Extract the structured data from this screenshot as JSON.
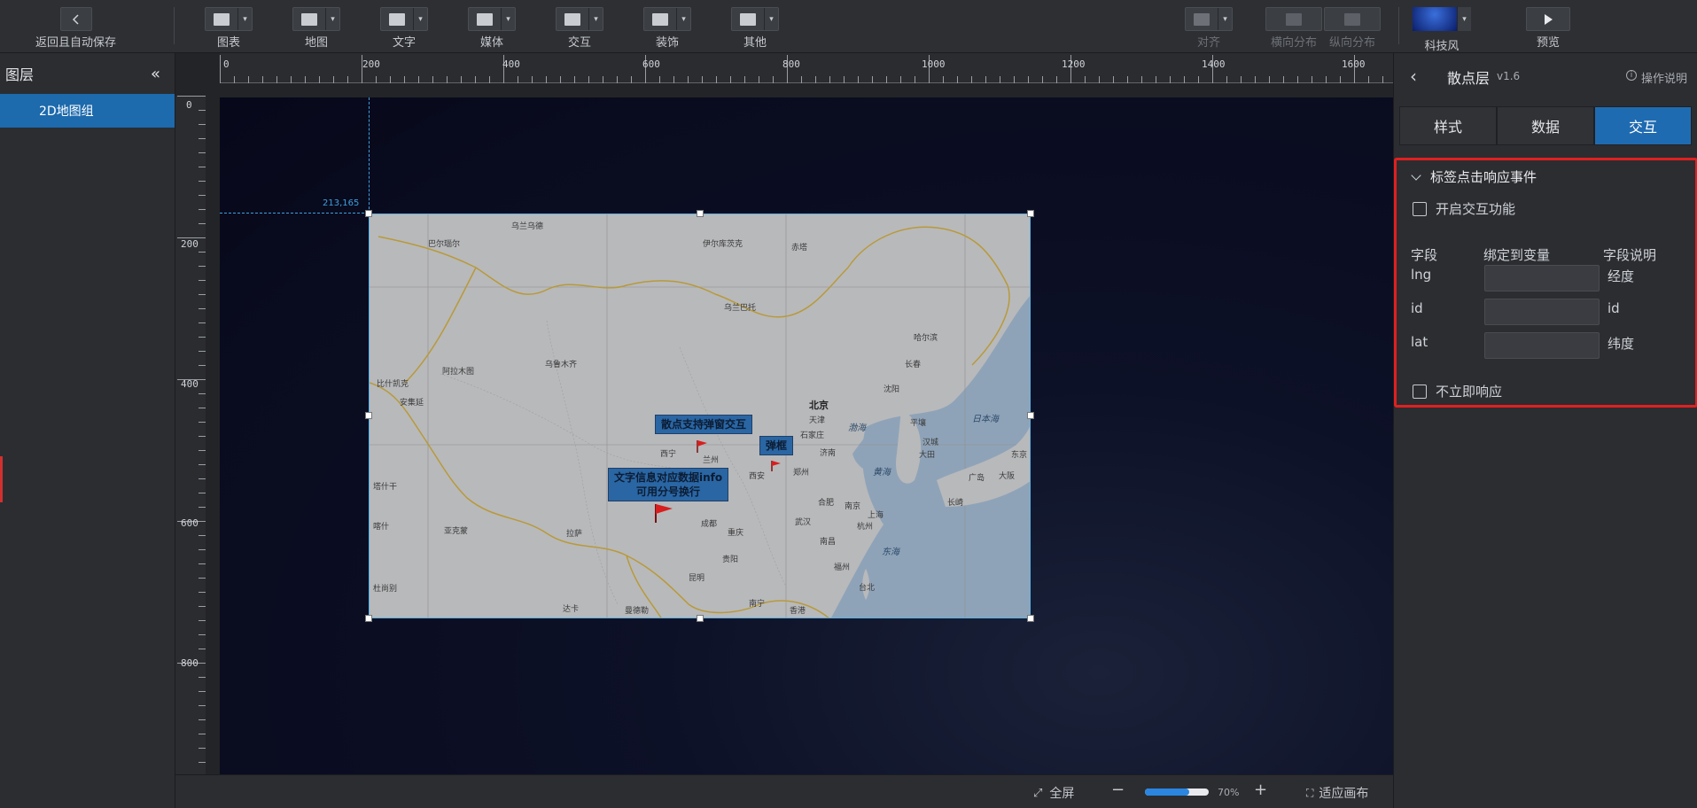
{
  "toolbar": {
    "back_label": "返回且自动保存",
    "groups": [
      {
        "label": "图表",
        "icon": "chart-icon"
      },
      {
        "label": "地图",
        "icon": "map-icon"
      },
      {
        "label": "文字",
        "icon": "text-icon"
      },
      {
        "label": "媒体",
        "icon": "media-icon"
      },
      {
        "label": "交互",
        "icon": "interaction-icon"
      },
      {
        "label": "装饰",
        "icon": "decoration-icon"
      },
      {
        "label": "其他",
        "icon": "other-icon"
      }
    ],
    "align_label": "对齐",
    "hdist_label": "横向分布",
    "vdist_label": "纵向分布",
    "theme_label": "科技风",
    "preview_label": "预览"
  },
  "layers": {
    "title": "图层",
    "items": [
      {
        "label": "2D地图组"
      }
    ]
  },
  "ruler": {
    "top": [
      "0",
      "200",
      "400",
      "600",
      "800",
      "1000",
      "1200",
      "1400",
      "1600"
    ],
    "left": [
      "0",
      "200",
      "400",
      "600",
      "800"
    ]
  },
  "canvas": {
    "coord": "213,165",
    "map": {
      "label1": "散点支持弹窗交互",
      "label2": "弹框",
      "label3_line1": "文字信息对应数据info",
      "label3_line2": "可用分号换行",
      "cities": {
        "beijing": "北京",
        "tianjin": "天津",
        "shijiazhuang": "石家庄",
        "jinan": "济南",
        "zhengzhou": "郑州",
        "xian": "西安",
        "xining": "西宁",
        "lanzhou": "兰州",
        "chengdu": "成都",
        "chongqing": "重庆",
        "wuhan": "武汉",
        "nanjing": "南京",
        "shanghai": "上海",
        "hangzhou": "杭州",
        "hefei": "合肥",
        "nanchang": "南昌",
        "fuzhou": "福州",
        "taibei": "台北",
        "guiyang": "贵阳",
        "kunming": "昆明",
        "nanning": "南宁",
        "xianggang": "香港",
        "lasa": "拉萨",
        "wulumuqi": "乌鲁木齐",
        "wulanbatuo": "乌兰巴托",
        "shenyang": "沈阳",
        "changchun": "长春",
        "haerbin": "哈尔滨",
        "pingrang": "平壤",
        "hancheng": "汉城",
        "dalian": "大田",
        "guangdao": "广岛",
        "daban": "大阪",
        "dongjing": "东京",
        "changqi": "长崎",
        "yellow_sea": "黄海",
        "bohai": "渤海",
        "east_sea": "东海",
        "japan_sea": "日本海",
        "anxi": "安集延",
        "alatu": "阿拉木图",
        "bishikaike": "比什凯克",
        "mazha": "巴尔瑙尔",
        "balnaul": "巴尔瑙尔",
        "yilukucike": "伊尔库茨克",
        "chita": "赤塔",
        "wulan": "乌兰乌德",
        "kaxingjia": "喀什",
        "tashigan": "塔什干",
        "dushanbe": "杜尚别",
        "jinsha": "亚克蒙",
        "dalan": "达卡",
        "mandelei": "曼德勒"
      }
    }
  },
  "rpanel": {
    "back": "‹",
    "title": "散点层",
    "version": "v1.6",
    "help": "操作说明",
    "tabs": [
      {
        "label": "样式"
      },
      {
        "label": "数据"
      },
      {
        "label": "交互"
      }
    ],
    "section_title": "标签点击响应事件",
    "enable_label": "开启交互功能",
    "col_field": "字段",
    "col_var": "绑定到变量",
    "col_desc": "字段说明",
    "rows": [
      {
        "field": "lng",
        "desc": "经度",
        "value": ""
      },
      {
        "field": "id",
        "desc": "id",
        "value": ""
      },
      {
        "field": "lat",
        "desc": "纬度",
        "value": ""
      }
    ],
    "no_immediate_label": "不立即响应",
    "highlight_color": "#e02020"
  },
  "bottom": {
    "fullscreen": "全屏",
    "zoom": "70%",
    "zoom_fraction": 0.7,
    "fit": "适应画布"
  },
  "colors": {
    "accent": "#1f6bb1",
    "selection": "#56b3e8"
  }
}
